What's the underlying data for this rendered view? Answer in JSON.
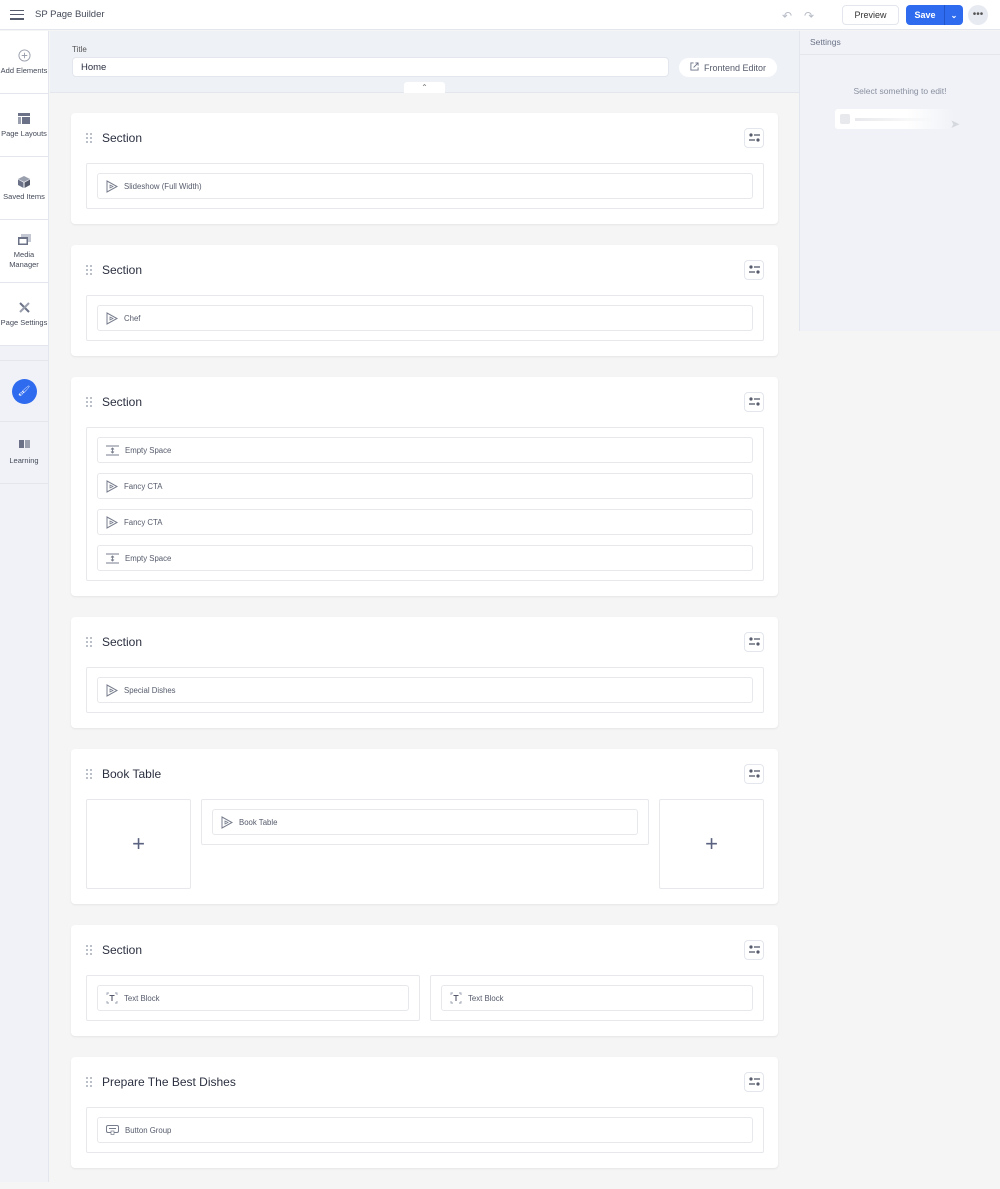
{
  "topbar": {
    "app_title": "SP Page Builder",
    "preview_label": "Preview",
    "save_label": "Save",
    "more_label": "•••"
  },
  "sidebar": {
    "items": [
      {
        "label": "Add Elements",
        "icon": "plus-circle-icon"
      },
      {
        "label": "Page Layouts",
        "icon": "layout-icon"
      },
      {
        "label": "Saved Items",
        "icon": "box-icon"
      },
      {
        "label": "Media Manager",
        "icon": "image-icon"
      },
      {
        "label": "Page Settings",
        "icon": "tools-icon"
      }
    ],
    "learning_label": "Learning"
  },
  "title_area": {
    "label": "Title",
    "value": "Home",
    "frontend_editor_label": "Frontend Editor"
  },
  "settings": {
    "header": "Settings",
    "empty_message": "Select something to edit!"
  },
  "colors": {
    "accent": "#2f6bef"
  },
  "sections": [
    {
      "title": "Section",
      "columns": [
        {
          "elements": [
            {
              "label": "Slideshow (Full Width)",
              "icon": "addon"
            }
          ]
        }
      ]
    },
    {
      "title": "Section",
      "columns": [
        {
          "elements": [
            {
              "label": "Chef",
              "icon": "addon"
            }
          ]
        }
      ]
    },
    {
      "title": "Section",
      "columns": [
        {
          "elements": [
            {
              "label": "Empty Space",
              "icon": "space"
            },
            {
              "label": "Fancy CTA",
              "icon": "addon"
            },
            {
              "label": "Fancy CTA",
              "icon": "addon"
            },
            {
              "label": "Empty Space",
              "icon": "space"
            }
          ]
        }
      ]
    },
    {
      "title": "Section",
      "columns": [
        {
          "elements": [
            {
              "label": "Special Dishes",
              "icon": "addon"
            }
          ]
        }
      ]
    },
    {
      "title": "Book Table",
      "columns": [
        {
          "empty": true,
          "plus": "+"
        },
        {
          "elements": [
            {
              "label": "Book Table",
              "icon": "addon"
            }
          ]
        },
        {
          "empty": true,
          "plus": "+"
        }
      ]
    },
    {
      "title": "Section",
      "columns": [
        {
          "elements": [
            {
              "label": "Text Block",
              "icon": "text"
            }
          ]
        },
        {
          "elements": [
            {
              "label": "Text Block",
              "icon": "text"
            }
          ]
        }
      ]
    },
    {
      "title": "Prepare The Best Dishes",
      "columns": [
        {
          "elements": [
            {
              "label": "Button Group",
              "icon": "button"
            }
          ]
        }
      ]
    }
  ]
}
